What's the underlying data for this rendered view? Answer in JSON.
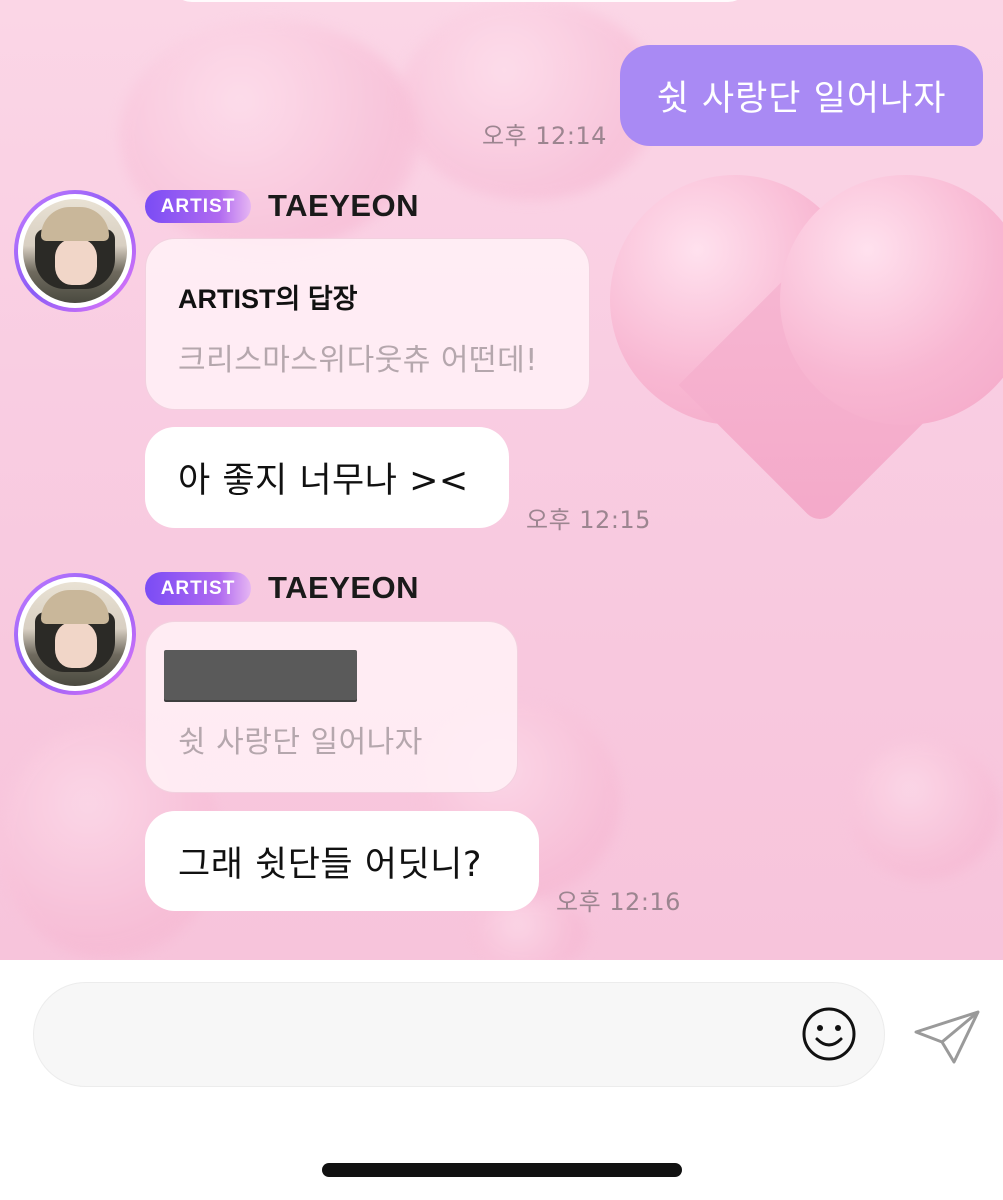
{
  "messages": {
    "outgoing": {
      "text": "쉿 사랑단 일어나자",
      "time": "오후 12:14"
    },
    "artist_block_1": {
      "badge": "ARTIST",
      "name": "TAEYEON",
      "reply_title": "ARTIST의 답장",
      "reply_quote": "크리스마스위다웃츄 어떤데!",
      "message": "아 좋지 너무나 ><",
      "time": "오후 12:15"
    },
    "artist_block_2": {
      "badge": "ARTIST",
      "name": "TAEYEON",
      "reply_quote": "쉿 사랑단 일어나자",
      "message": "그래 쉿단들 어딧니?",
      "time": "오후 12:16"
    }
  },
  "composer": {
    "placeholder": "",
    "accent_color": "#a98af4",
    "icons": [
      "smile-icon",
      "send-icon"
    ]
  },
  "colors": {
    "outgoing_bubble": "#a98af4",
    "background_pink": "#f9cde2",
    "badge_gradient_start": "#7a4cf5"
  }
}
